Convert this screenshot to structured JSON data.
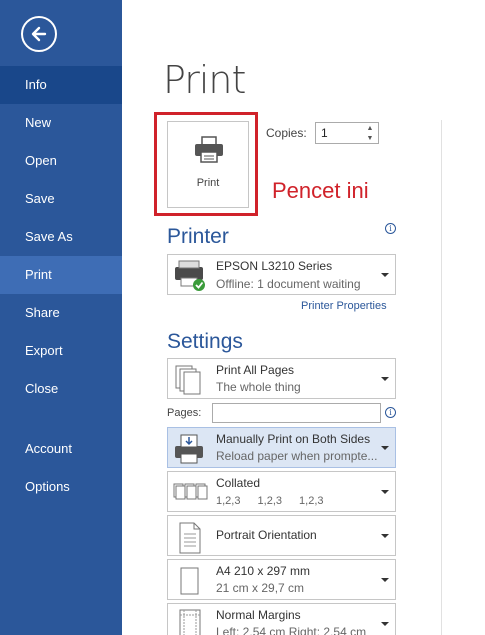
{
  "sidebar": {
    "items": [
      {
        "label": "Info"
      },
      {
        "label": "New"
      },
      {
        "label": "Open"
      },
      {
        "label": "Save"
      },
      {
        "label": "Save As"
      },
      {
        "label": "Print"
      },
      {
        "label": "Share"
      },
      {
        "label": "Export"
      },
      {
        "label": "Close"
      },
      {
        "label": "Account"
      },
      {
        "label": "Options"
      }
    ]
  },
  "main": {
    "title": "Print",
    "print_button_label": "Print",
    "copies_label": "Copies:",
    "copies_value": "1",
    "annotation": "Pencet ini"
  },
  "printer": {
    "heading": "Printer",
    "name": "EPSON L3210 Series",
    "status": "Offline: 1 document waiting",
    "properties_link": "Printer Properties"
  },
  "settings": {
    "heading": "Settings",
    "pages_label": "Pages:",
    "pages_value": "",
    "items": [
      {
        "line1": "Print All Pages",
        "line2": "The whole thing"
      },
      {
        "line1": "Manually Print on Both Sides",
        "line2": "Reload paper when prompte..."
      },
      {
        "line1": "Collated",
        "line2": "1,2,3 1,2,3 1,2,3"
      },
      {
        "line1": "Portrait Orientation",
        "line2": ""
      },
      {
        "line1": "A4 210 x 297 mm",
        "line2": "21 cm x 29,7 cm"
      },
      {
        "line1": "Normal Margins",
        "line2": "Left: 2,54 cm Right: 2,54 cm"
      }
    ]
  },
  "colors": {
    "sidebar": "#2b579a",
    "accent": "#2b579a",
    "annotation": "#d0222a"
  }
}
